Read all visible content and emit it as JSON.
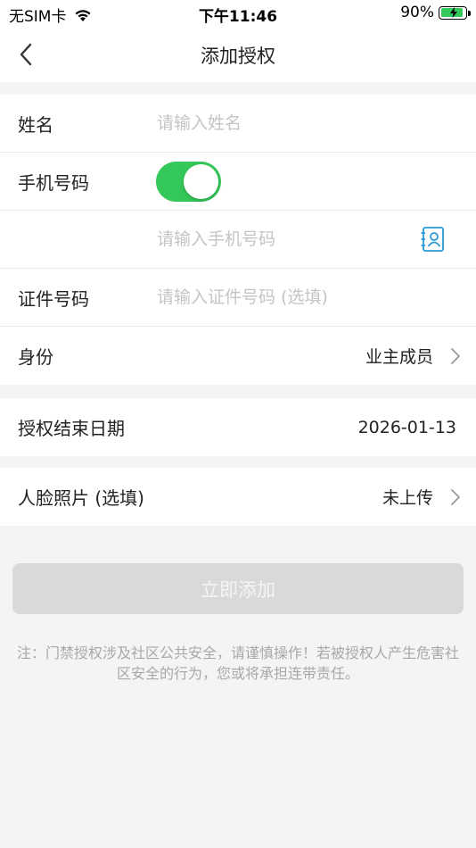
{
  "status_bar": {
    "carrier": "无SIM卡",
    "time": "下午11:46",
    "battery_percent": "90%",
    "battery_level": 0.9,
    "battery_color": "#34c759"
  },
  "nav": {
    "title": "添加授权",
    "back_icon": "chevron-left-icon"
  },
  "form": {
    "name": {
      "label": "姓名",
      "placeholder": "请输入姓名"
    },
    "phone": {
      "label": "手机号码",
      "toggle_on": true,
      "toggle_color": "#34c759",
      "placeholder": "请输入手机号码",
      "contact_icon": "contact-card-icon"
    },
    "id_number": {
      "label": "证件号码",
      "placeholder": "请输入证件号码 (选填)"
    },
    "identity": {
      "label": "身份",
      "value": "业主成员"
    },
    "end_date": {
      "label": "授权结束日期",
      "value": "2026-01-13"
    },
    "face_photo": {
      "label": "人脸照片 (选填)",
      "value": "未上传"
    }
  },
  "submit": {
    "label": "立即添加",
    "disabled": true
  },
  "note": "注：门禁授权涉及社区公共安全，请谨慎操作！若被授权人产生危害社区安全的行为，您或将承担连带责任。"
}
